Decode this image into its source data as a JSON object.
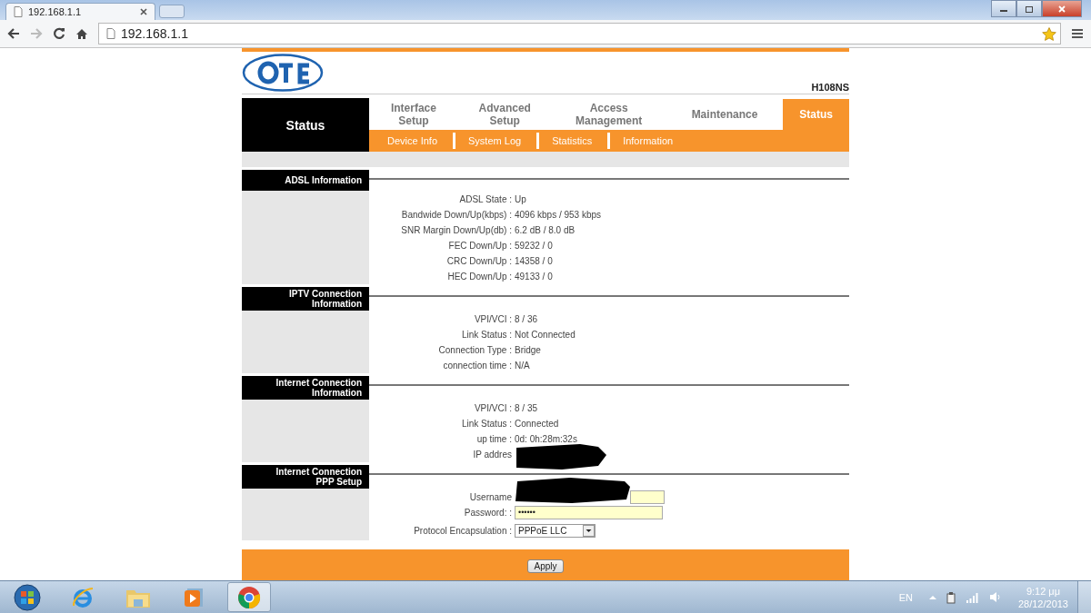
{
  "browser": {
    "tab_title": "192.168.1.1",
    "url": "192.168.1.1"
  },
  "header": {
    "model": "H108NS"
  },
  "nav": {
    "title": "Status",
    "tabs": [
      {
        "label": "Interface Setup",
        "selected": false
      },
      {
        "label": "Advanced Setup",
        "selected": false
      },
      {
        "label": "Access Management",
        "selected": false
      },
      {
        "label": "Maintenance",
        "selected": false
      },
      {
        "label": "Status",
        "selected": true
      }
    ],
    "subtabs": [
      {
        "label": "Device Info"
      },
      {
        "label": "System Log"
      },
      {
        "label": "Statistics"
      },
      {
        "label": "Information"
      }
    ]
  },
  "sections": [
    {
      "title": "ADSL Information",
      "rows": [
        {
          "kind": "text",
          "label": "ADSL State :",
          "value": "Up"
        },
        {
          "kind": "text",
          "label": "Bandwide Down/Up(kbps) :",
          "value": "4096 kbps / 953 kbps"
        },
        {
          "kind": "text",
          "label": "SNR Margin Down/Up(db) :",
          "value": "6.2 dB / 8.0 dB"
        },
        {
          "kind": "text",
          "label": "FEC Down/Up :",
          "value": "59232 / 0"
        },
        {
          "kind": "text",
          "label": "CRC Down/Up :",
          "value": "14358 / 0"
        },
        {
          "kind": "text",
          "label": "HEC Down/Up :",
          "value": "49133 / 0"
        }
      ]
    },
    {
      "title": "IPTV Connection Information",
      "rows": [
        {
          "kind": "text",
          "label": "VPI/VCI :",
          "value": "8 / 36"
        },
        {
          "kind": "text",
          "label": "Link Status :",
          "value": "Not Connected"
        },
        {
          "kind": "text",
          "label": "Connection Type :",
          "value": "Bridge"
        },
        {
          "kind": "text",
          "label": "connection time :",
          "value": "N/A"
        }
      ]
    },
    {
      "title": "Internet Connection Information",
      "rows": [
        {
          "kind": "text",
          "label": "VPI/VCI :",
          "value": "8 / 35"
        },
        {
          "kind": "text",
          "label": "Link Status :",
          "value": "Connected"
        },
        {
          "kind": "text",
          "label": "up time :",
          "value": "0d: 0h:28m:32s"
        },
        {
          "kind": "redacted",
          "label": "IP addres"
        }
      ]
    },
    {
      "title": "Internet Connection PPP Setup",
      "rows": [
        {
          "kind": "input-redacted",
          "label": "Username"
        },
        {
          "kind": "password",
          "label": "Password: :",
          "value": "••••••"
        },
        {
          "kind": "select",
          "label": "Protocol Encapsulation :",
          "value": "PPPoE LLC"
        }
      ]
    }
  ],
  "footer": {
    "button": "Apply"
  },
  "taskbar": {
    "apps": [
      {
        "kind": "orb",
        "selected": false
      },
      {
        "kind": "ie",
        "selected": false
      },
      {
        "kind": "folder",
        "selected": false
      },
      {
        "kind": "media",
        "selected": false
      },
      {
        "kind": "chrome",
        "selected": true
      }
    ],
    "language": "EN",
    "time": "9:12 μμ",
    "date": "28/12/2013"
  }
}
